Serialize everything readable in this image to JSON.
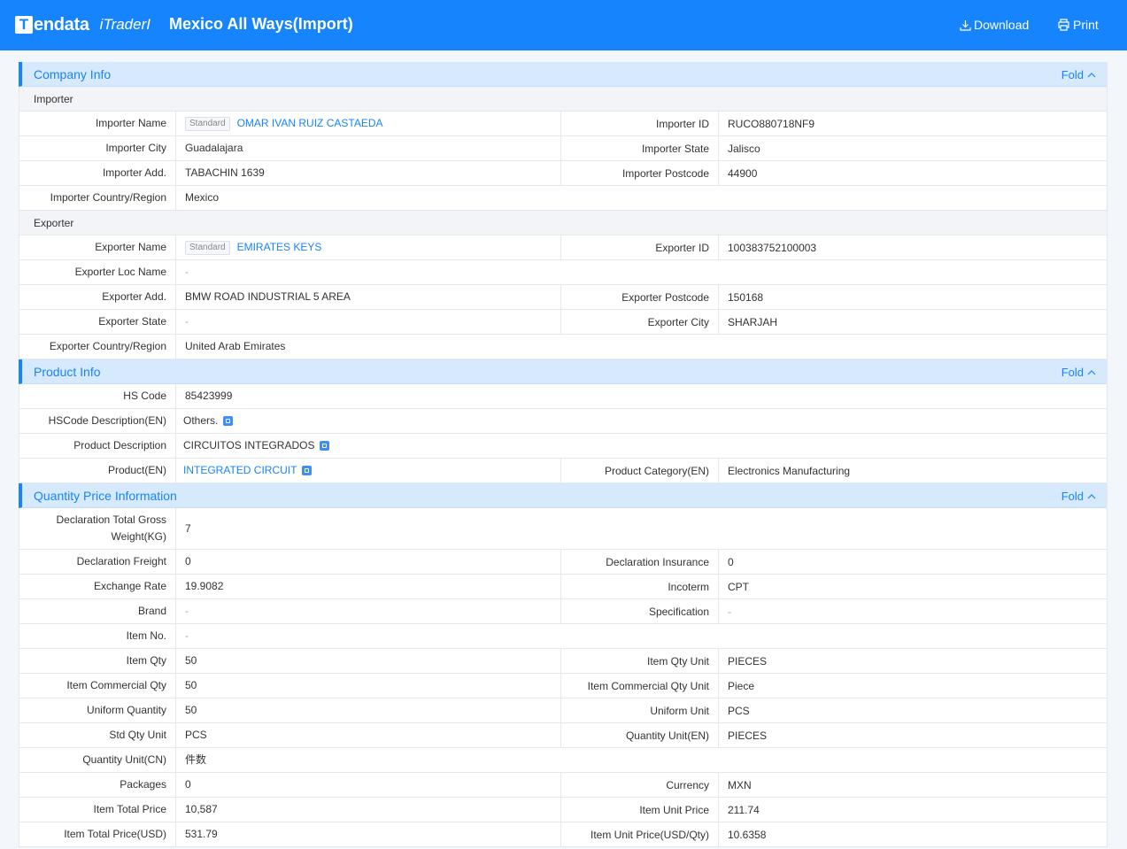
{
  "header": {
    "logo_mark": "T",
    "logo_text": "endata",
    "logo_sub": "iTraderI",
    "title": "Mexico All Ways(Import)",
    "download_label": "Download",
    "print_label": "Print"
  },
  "fold_label": "Fold",
  "company": {
    "title": "Company Info",
    "importer_heading": "Importer",
    "exporter_heading": "Exporter",
    "tag_label": "Standard",
    "importer_name_label": "Importer Name",
    "importer_name": "OMAR IVAN RUIZ CASTAEDA",
    "importer_id_label": "Importer ID",
    "importer_id": "RUCO880718NF9",
    "importer_city_label": "Importer City",
    "importer_city": "Guadalajara",
    "importer_state_label": "Importer State",
    "importer_state": "Jalisco",
    "importer_add_label": "Importer Add.",
    "importer_add": "TABACHIN 1639",
    "importer_postcode_label": "Importer Postcode",
    "importer_postcode": "44900",
    "importer_country_label": "Importer Country/Region",
    "importer_country": "Mexico",
    "exporter_name_label": "Exporter Name",
    "exporter_name": "EMIRATES KEYS",
    "exporter_id_label": "Exporter ID",
    "exporter_id": "100383752100003",
    "exporter_loc_label": "Exporter Loc Name",
    "exporter_loc": "-",
    "exporter_add_label": "Exporter Add.",
    "exporter_add": "BMW ROAD INDUSTRIAL 5 AREA",
    "exporter_postcode_label": "Exporter Postcode",
    "exporter_postcode": "150168",
    "exporter_state_label": "Exporter State",
    "exporter_state": "-",
    "exporter_city_label": "Exporter City",
    "exporter_city": "SHARJAH",
    "exporter_country_label": "Exporter Country/Region",
    "exporter_country": "United Arab Emirates"
  },
  "product": {
    "title": "Product Info",
    "hs_code_label": "HS Code",
    "hs_code": "85423999",
    "hs_desc_label": "HSCode Description(EN)",
    "hs_desc": "Others.",
    "prod_desc_label": "Product Description",
    "prod_desc": "CIRCUITOS INTEGRADOS",
    "product_en_label": "Product(EN)",
    "product_en": "INTEGRATED CIRCUIT",
    "category_label": "Product Category(EN)",
    "category": "Electronics Manufacturing"
  },
  "quantity": {
    "title": "Quantity Price Information",
    "gross_weight_label": "Declaration Total Gross Weight(KG)",
    "gross_weight": "7",
    "freight_label": "Declaration Freight",
    "freight": "0",
    "insurance_label": "Declaration Insurance",
    "insurance": "0",
    "exchange_rate_label": "Exchange Rate",
    "exchange_rate": "19.9082",
    "incoterm_label": "Incoterm",
    "incoterm": "CPT",
    "brand_label": "Brand",
    "brand": "-",
    "spec_label": "Specification",
    "spec": "-",
    "item_no_label": "Item No.",
    "item_no": "-",
    "item_qty_label": "Item Qty",
    "item_qty": "50",
    "item_qty_unit_label": "Item Qty Unit",
    "item_qty_unit": "PIECES",
    "commercial_qty_label": "Item Commercial Qty",
    "commercial_qty": "50",
    "commercial_qty_unit_label": "Item Commercial Qty Unit",
    "commercial_qty_unit": "Piece",
    "uniform_qty_label": "Uniform Quantity",
    "uniform_qty": "50",
    "uniform_unit_label": "Uniform Unit",
    "uniform_unit": "PCS",
    "std_qty_unit_label": "Std Qty Unit",
    "std_qty_unit": "PCS",
    "qty_unit_en_label": "Quantity Unit(EN)",
    "qty_unit_en": "PIECES",
    "qty_unit_cn_label": "Quantity Unit(CN)",
    "qty_unit_cn": "件数",
    "packages_label": "Packages",
    "packages": "0",
    "currency_label": "Currency",
    "currency": "MXN",
    "total_price_label": "Item Total Price",
    "total_price": "10,587",
    "unit_price_label": "Item Unit Price",
    "unit_price": "211.74",
    "total_price_usd_label": "Item Total Price(USD)",
    "total_price_usd": "531.79",
    "unit_price_usd_label": "Item Unit Price(USD/Qty)",
    "unit_price_usd": "10.6358"
  }
}
